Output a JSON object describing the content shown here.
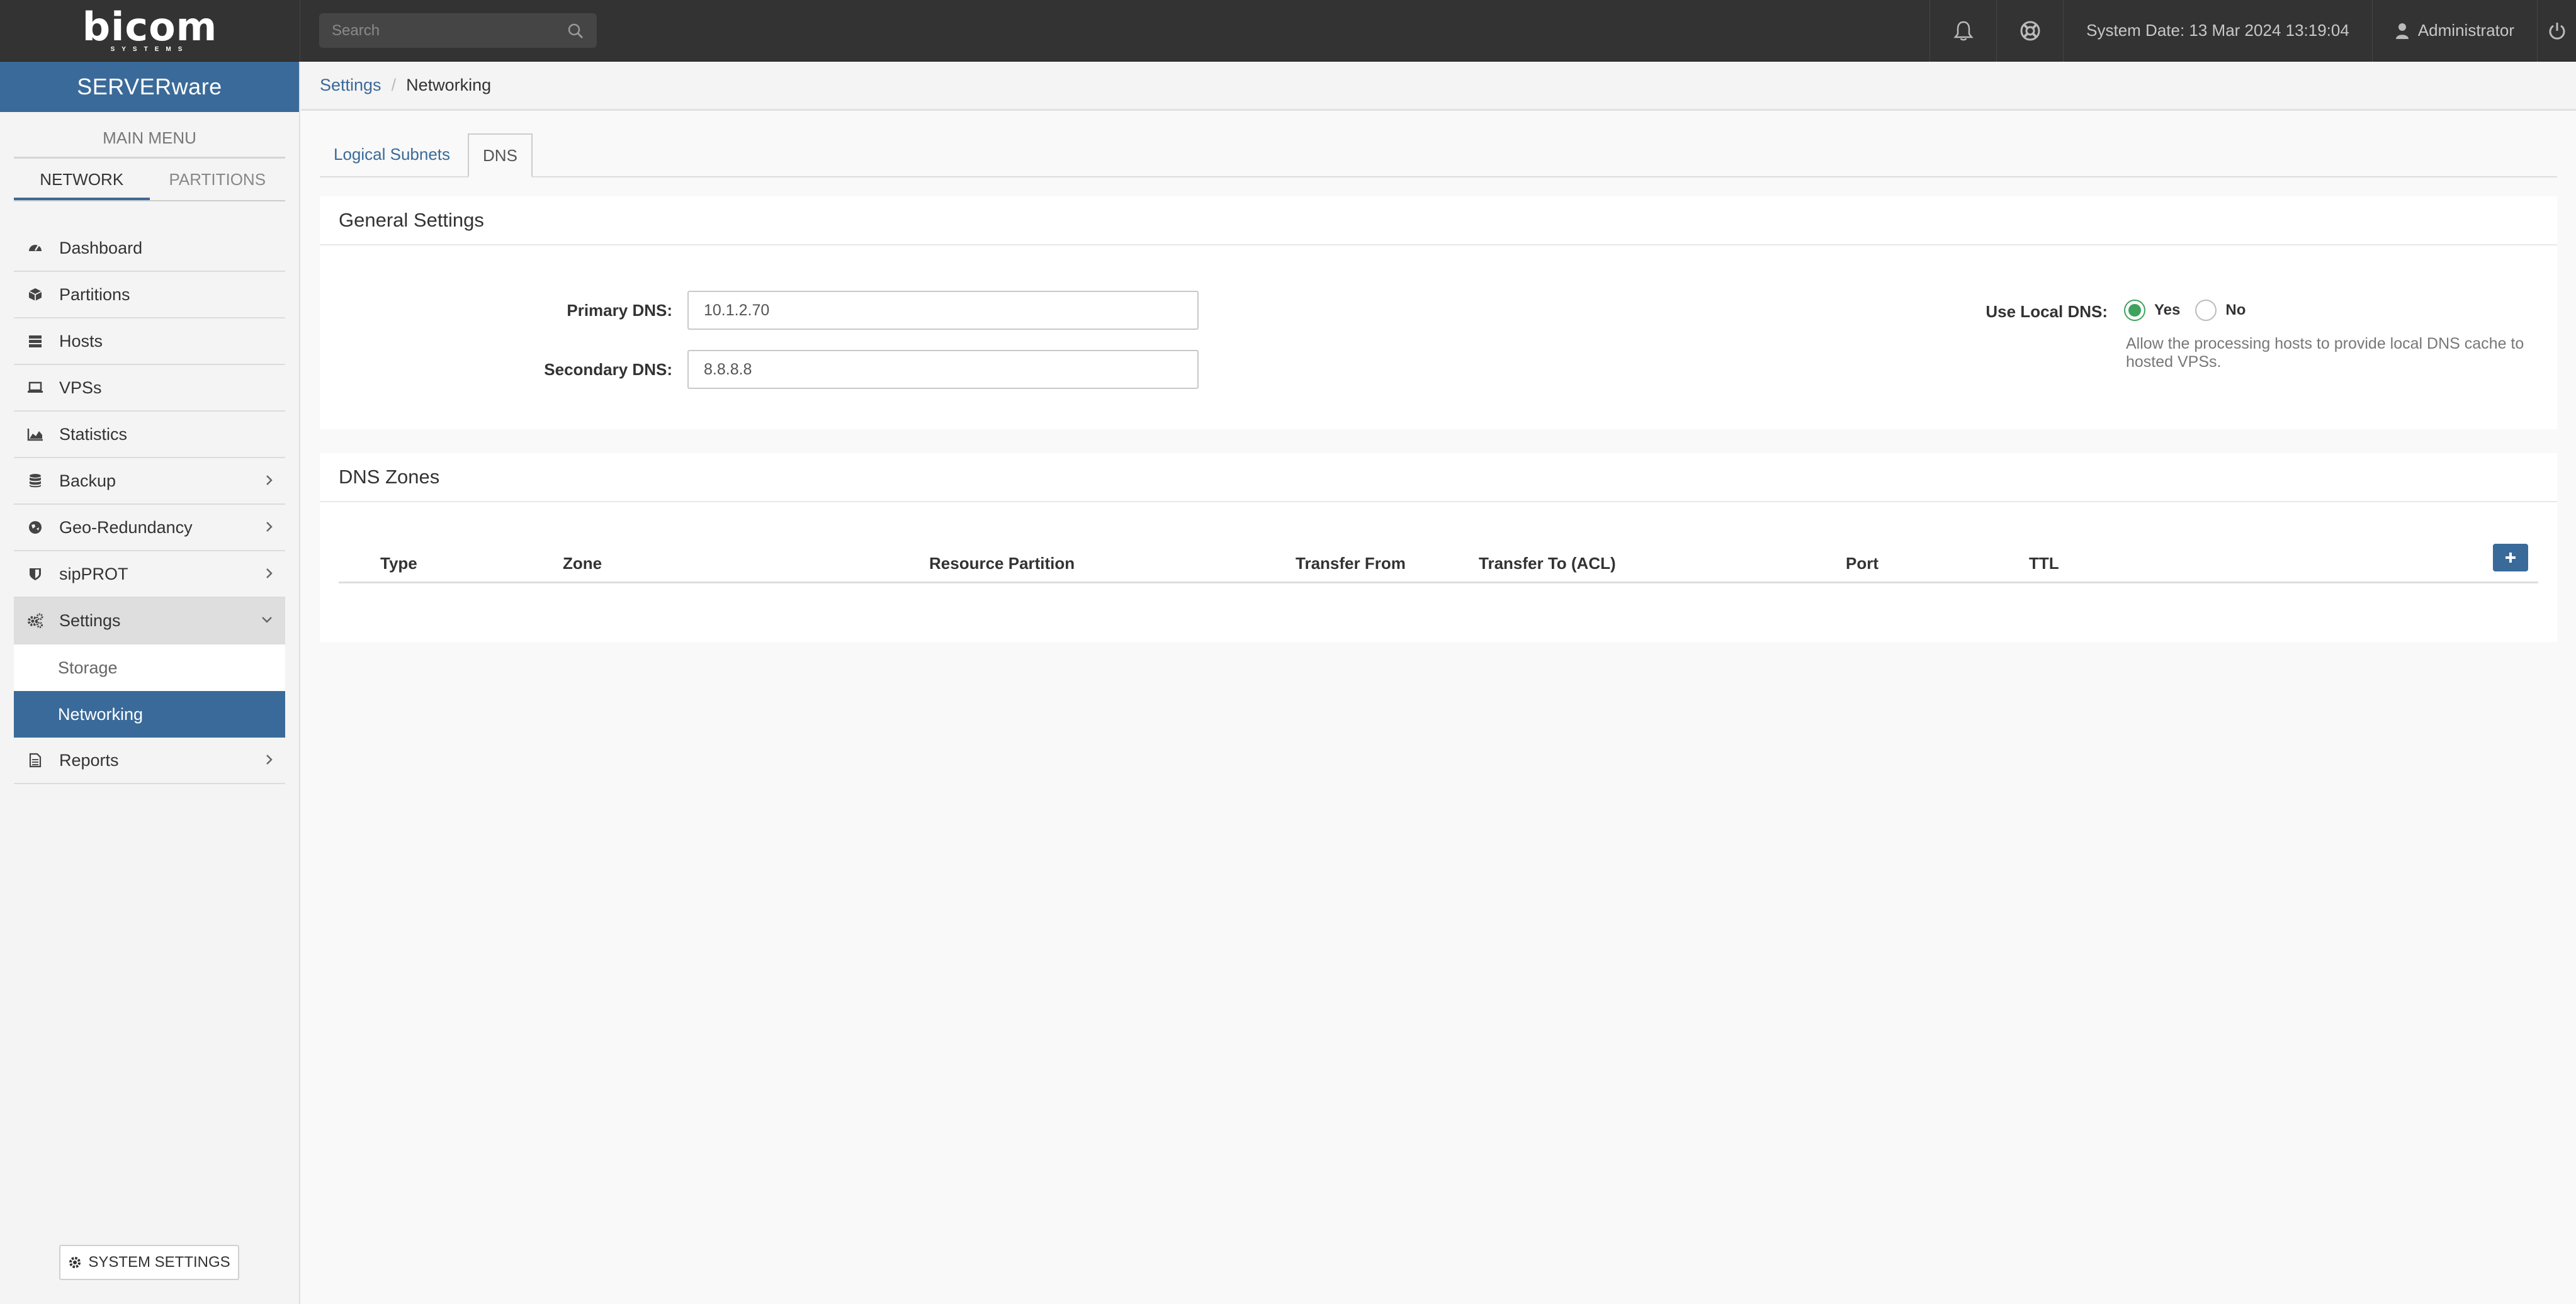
{
  "topbar": {
    "logo": "bicom",
    "logo_sub": "SYSTEMS",
    "search_placeholder": "Search",
    "system_date": "System Date: 13 Mar 2024 13:19:04",
    "user": "Administrator"
  },
  "sidebar": {
    "brand": "SERVERware",
    "main_menu": "MAIN MENU",
    "tabs": [
      {
        "label": "NETWORK",
        "active": true
      },
      {
        "label": "PARTITIONS",
        "active": false
      }
    ],
    "items": [
      {
        "label": "Dashboard",
        "icon": "dashboard-icon"
      },
      {
        "label": "Partitions",
        "icon": "cube-icon"
      },
      {
        "label": "Hosts",
        "icon": "server-icon"
      },
      {
        "label": "VPSs",
        "icon": "laptop-icon"
      },
      {
        "label": "Statistics",
        "icon": "area-chart-icon"
      },
      {
        "label": "Backup",
        "icon": "database-icon"
      },
      {
        "label": "Geo-Redundancy",
        "icon": "globe-icon"
      },
      {
        "label": "sipPROT",
        "icon": "shield-icon"
      },
      {
        "label": "Settings",
        "icon": "cogs-icon"
      },
      {
        "label": "Reports",
        "icon": "file-icon"
      }
    ],
    "settings_sub": [
      {
        "label": "Storage",
        "active": false
      },
      {
        "label": "Networking",
        "active": true
      }
    ],
    "system_settings": "SYSTEM SETTINGS"
  },
  "breadcrumb": {
    "parent": "Settings",
    "current": "Networking"
  },
  "tabs": [
    {
      "label": "Logical Subnets",
      "active": false
    },
    {
      "label": "DNS",
      "active": true
    }
  ],
  "general": {
    "title": "General Settings",
    "primary_label": "Primary DNS:",
    "primary_value": "10.1.2.70",
    "secondary_label": "Secondary DNS:",
    "secondary_value": "8.8.8.8",
    "local_label": "Use Local DNS:",
    "yes": "Yes",
    "no": "No",
    "local_selected": "Yes",
    "hint": "Allow the processing hosts to provide local DNS cache to hosted VPSs."
  },
  "zones": {
    "title": "DNS Zones",
    "columns": [
      "Type",
      "Zone",
      "Resource Partition",
      "Transfer From",
      "Transfer To (ACL)",
      "Port",
      "TTL"
    ],
    "rows": []
  },
  "colors": {
    "topbar": "#333333",
    "brand": "#3a6a99",
    "accent": "#3a6a99",
    "radio_on": "#3da35d"
  }
}
